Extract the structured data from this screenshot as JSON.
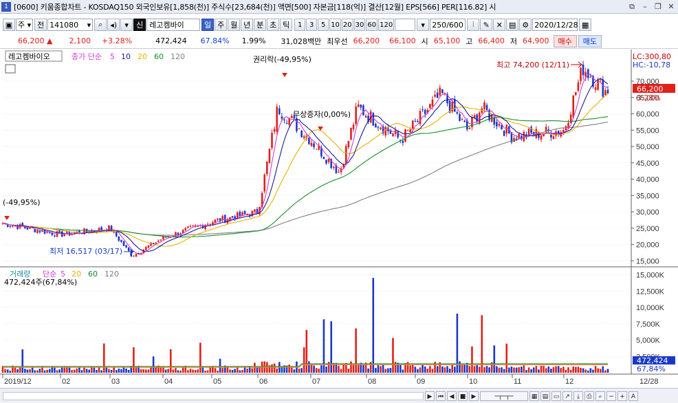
{
  "window": {
    "number": "1",
    "title": "[0600] 키움종합차트 - KOSDAQ150 외국인보유[1,858(천)] 주식수[23,684(천)] 액면[500] 자본금[118(억)] 결산[12월] EPS[566] PER[116.82] 시"
  },
  "toolbar": {
    "market": "주",
    "prev_label": "전",
    "code": "141080",
    "stock_name": "레고켐바이",
    "shin_label": "신",
    "periods": [
      "일",
      "주",
      "월",
      "년",
      "분",
      "초",
      "틱"
    ],
    "active_period": "일",
    "intervals": [
      "1",
      "3",
      "5",
      "10",
      "20",
      "30",
      "60",
      "120"
    ],
    "count": "250",
    "count_total": "/600",
    "date": "2020/12/28"
  },
  "quote": {
    "price": "66,200",
    "change": "2,100",
    "change_pct": "+3.28%",
    "volume": "472,424",
    "volume_ratio": "67.84%",
    "turnover_pct": "1.99%",
    "amount": "31,028백만",
    "best_label": "최우선",
    "best_price": "66,200",
    "ask": "66,100",
    "open_label": "시",
    "open": "65,100",
    "high_label": "고",
    "high": "66,400",
    "low_label": "저",
    "low": "64,900",
    "buy_label": "매수",
    "sell_label": "매도"
  },
  "price_panel": {
    "stock_label": "레고켐바이오",
    "ma_label": "종가 단순",
    "ma_periods": [
      "5",
      "10",
      "20",
      "60",
      "120"
    ],
    "lc_label": "LC:300,80",
    "hc_label": "HC:-10,78",
    "current_tag": "66,200",
    "current_pct": "3.28%",
    "y_ticks": [
      "70,000",
      "65,000",
      "60,000",
      "55,000",
      "50,000",
      "45,000",
      "40,000",
      "35,000",
      "30,000",
      "25,000",
      "20,000",
      "15,000"
    ],
    "annotations": {
      "left": "(-49,95%)",
      "rights": "권리락(-49,95%)",
      "issue": "무상증자(0,00%)",
      "high": "최고 74,200 (12/11)",
      "low": "최저 16,517 (03/17)"
    }
  },
  "volume_panel": {
    "label": "거래량",
    "ma_label": "단순",
    "ma_periods": [
      "5",
      "20",
      "60",
      "120"
    ],
    "info": "472,424주(67,84%)",
    "y_ticks": [
      "15,000K",
      "12,500K",
      "10,000K",
      "7,500K",
      "5,000K",
      "2,500K"
    ],
    "current_tag": "472,424",
    "current_pct": "67,84%"
  },
  "x_axis": [
    "2019/12",
    "02",
    "03",
    "04",
    "05",
    "06",
    "07",
    "08",
    "09",
    "10",
    "11",
    "12",
    "12/28"
  ],
  "colors": {
    "up": "#e0201a",
    "down": "#1a38c8",
    "ma5": "#d03cd0",
    "ma10": "#1a1a8c",
    "ma20": "#e8b000",
    "ma60": "#1a8c2c",
    "ma120": "#808080",
    "accent": "#3b62c8"
  },
  "chart_data": {
    "type": "candlestick",
    "months": [
      "2019/12",
      "02",
      "03",
      "04",
      "05",
      "06",
      "07",
      "08",
      "09",
      "10",
      "11",
      "12"
    ],
    "ylim": [
      14000,
      78000
    ],
    "volume_ylim": [
      0,
      16000000
    ],
    "anchors": [
      {
        "x": "2019/12",
        "y": 26500
      },
      {
        "x": "2020/02",
        "y": 23000
      },
      {
        "x": "2020/03",
        "y": 25000
      },
      {
        "x": "2020/03/17",
        "y": 16517
      },
      {
        "x": "2020/04",
        "y": 22000
      },
      {
        "x": "2020/05",
        "y": 27000
      },
      {
        "x": "2020/06",
        "y": 30000
      },
      {
        "x": "2020/06 mid",
        "y": 62000
      },
      {
        "x": "2020/07",
        "y": 52000
      },
      {
        "x": "2020/07 end",
        "y": 42000
      },
      {
        "x": "2020/08",
        "y": 62000
      },
      {
        "x": "2020/09",
        "y": 52000
      },
      {
        "x": "2020/09 mid",
        "y": 66000
      },
      {
        "x": "2020/10",
        "y": 55000
      },
      {
        "x": "2020/10 mid",
        "y": 62000
      },
      {
        "x": "2020/11",
        "y": 53000
      },
      {
        "x": "2020/12",
        "y": 55000
      },
      {
        "x": "2020/12/11",
        "y": 74200
      },
      {
        "x": "2020/12/28",
        "y": 66200
      }
    ]
  }
}
